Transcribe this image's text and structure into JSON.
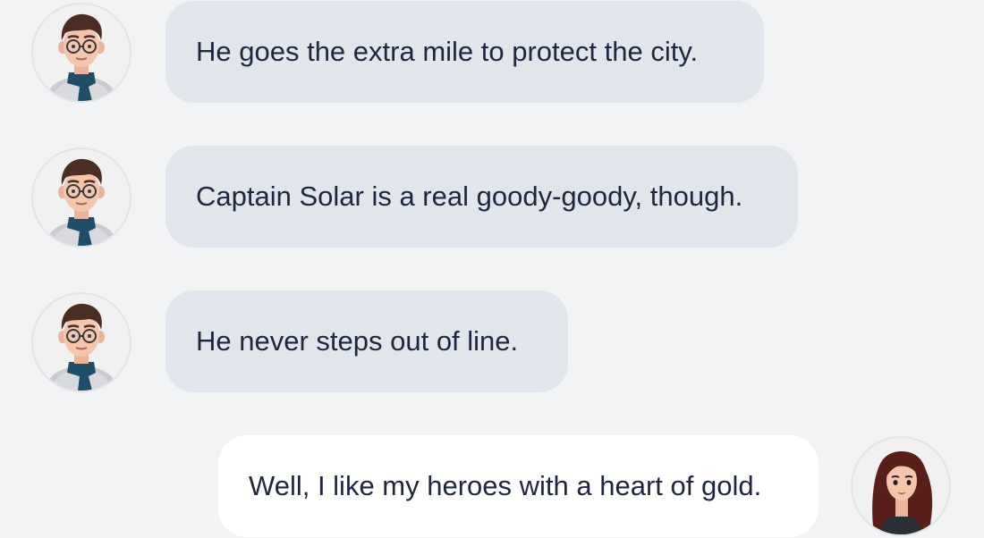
{
  "conversation": {
    "messages": [
      {
        "sender": "hero-fan",
        "direction": "incoming",
        "text": "He goes the extra mile to protect the city."
      },
      {
        "sender": "hero-fan",
        "direction": "incoming",
        "text": "Captain Solar is a real goody-goody, though."
      },
      {
        "sender": "hero-fan",
        "direction": "incoming",
        "text": "He never steps out of line."
      },
      {
        "sender": "user",
        "direction": "outgoing",
        "text": "Well, I like my heroes with a heart of gold."
      }
    ]
  },
  "avatars": {
    "male": "man-with-glasses-and-scarf-avatar",
    "female": "woman-with-long-hair-avatar"
  },
  "colors": {
    "background": "#f2f3f5",
    "incoming_bubble": "#e1e5ec",
    "outgoing_bubble": "#ffffff",
    "text": "#1e2640"
  }
}
